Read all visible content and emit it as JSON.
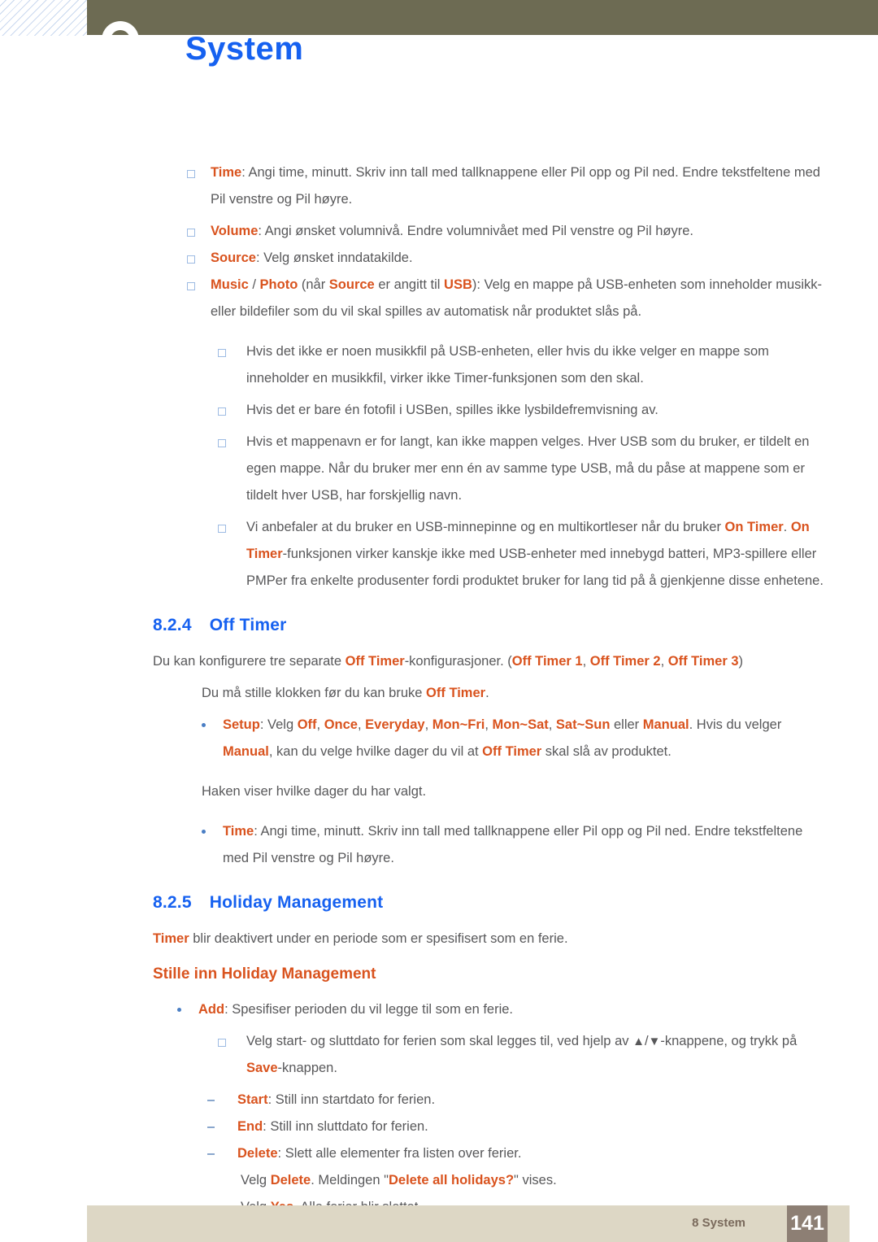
{
  "header": {
    "title": "System",
    "accent_color": "#1661f0",
    "bar_color": "#6d6b53"
  },
  "colors": {
    "keyword": "#d9531e",
    "heading": "#1661f0",
    "body": "#58585a",
    "footer_bar": "#ddd7c5",
    "footer_pageno_bg": "#8d7f74"
  },
  "top_list": {
    "items": [
      {
        "term": "Time",
        "rest": ": Angi time, minutt. Skriv inn tall med tallknappene eller Pil opp og Pil ned. Endre tekstfeltene med Pil venstre og Pil høyre."
      },
      {
        "term": "Volume",
        "rest": ": Angi ønsket volumnivå. Endre volumnivået med Pil venstre og Pil høyre."
      },
      {
        "term": "Source",
        "rest": ": Velg ønsket inndatakilde."
      }
    ],
    "music_photo": {
      "t1": "Music",
      "sep": " / ",
      "t2": "Photo",
      "mid": " (når ",
      "t3": "Source",
      "mid2": " er angitt til ",
      "t4": "USB",
      "rest": "): Velg en mappe på USB-enheten som inneholder musikk- eller bildefiler som du vil skal spilles av automatisk når produktet slås på."
    },
    "notes": [
      "Hvis det ikke er noen musikkfil på USB-enheten, eller hvis du ikke velger en mappe som inneholder en musikkfil, virker ikke Timer-funksjonen som den skal.",
      "Hvis det er bare én fotofil i USBen, spilles ikke lysbildefremvisning av.",
      "Hvis et mappenavn er for langt, kan ikke mappen velges. Hver USB som du bruker, er tildelt en egen mappe. Når du bruker mer enn én av samme type USB, må du påse at mappene som er tildelt hver USB, har forskjellig navn."
    ],
    "on_timer_note": {
      "p1": "Vi anbefaler at du bruker en USB-minnepinne og en multikortleser når du bruker ",
      "k1": "On Timer",
      "p2": ". ",
      "k2": "On Timer",
      "p3": "-funksjonen virker kanskje ikke med USB-enheter med innebygd batteri, MP3-spillere eller PMPer fra enkelte produsenter fordi produktet bruker for lang tid på å gjenkjenne disse enhetene."
    }
  },
  "section_824": {
    "number": "8.2.4",
    "title": "Off Timer",
    "intro": {
      "p1": "Du kan konfigurere tre separate ",
      "k1": "Off Timer",
      "p2": "-konfigurasjoner. (",
      "k2": "Off Timer 1",
      "p3": ", ",
      "k3": "Off Timer 2",
      "p4": ", ",
      "k4": "Off Timer 3",
      "p5": ")"
    },
    "clock_note": {
      "p1": "Du må stille klokken før du kan bruke ",
      "k1": "Off Timer",
      "p2": "."
    },
    "setup": {
      "term": "Setup",
      "p1": ": Velg ",
      "opts": [
        "Off",
        "Once",
        "Everyday",
        "Mon~Fri",
        "Mon~Sat",
        "Sat~Sun"
      ],
      "p2": " eller ",
      "k_manual": "Manual",
      "p3": ". Hvis du velger ",
      "k_manual2": "Manual",
      "p4": ", kan du velge hvilke dager du vil at ",
      "k_offtimer": "Off Timer",
      "p5": " skal slå av produktet."
    },
    "check_note": "Haken viser hvilke dager du har valgt.",
    "time": {
      "term": "Time",
      "rest": ": Angi time, minutt. Skriv inn tall med tallknappene eller Pil opp og Pil ned. Endre tekstfeltene med Pil venstre og Pil høyre."
    }
  },
  "section_825": {
    "number": "8.2.5",
    "title": "Holiday Management",
    "intro": {
      "k1": "Timer",
      "p1": " blir deaktivert under en periode som er spesifisert som en ferie."
    },
    "subheading": "Stille inn Holiday Management",
    "add": {
      "term": "Add",
      "rest": ": Spesifiser perioden du vil legge til som en ferie."
    },
    "select_dates": {
      "p1": "Velg start- og sluttdato for ferien som skal legges til, ved hjelp av ",
      "tri_up": "▲",
      "slash": "/",
      "tri_down": "▼",
      "p2": "-knappene, og trykk på ",
      "k1": "Save",
      "p3": "-knappen."
    },
    "dash_items": [
      {
        "term": "Start",
        "rest": ": Still inn startdato for ferien."
      },
      {
        "term": "End",
        "rest": ": Still inn sluttdato for ferien."
      },
      {
        "term": "Delete",
        "rest": ": Slett alle elementer fra listen over ferier."
      }
    ],
    "delete_msg": {
      "p1": "Velg ",
      "k1": "Delete",
      "p2": ". Meldingen \"",
      "k2": "Delete all holidays?",
      "p3": "\" vises."
    },
    "yes_msg": {
      "p1": "Velg ",
      "k1": "Yes",
      "p2": ". Alle ferier blir slettet."
    }
  },
  "footer": {
    "label": "8 System",
    "page_number": "141"
  }
}
